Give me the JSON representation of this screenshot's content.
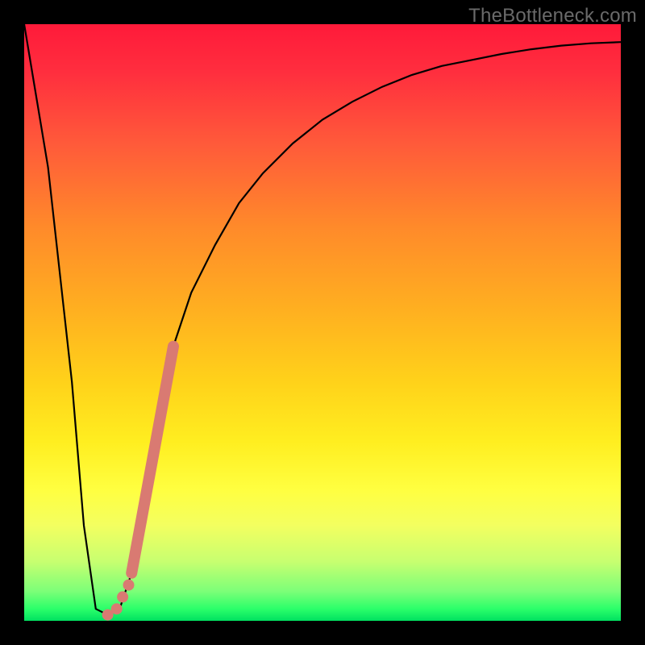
{
  "watermark": "TheBottleneck.com",
  "colors": {
    "marker": "#d97a72",
    "curve": "#000000"
  },
  "chart_data": {
    "type": "line",
    "title": "",
    "xlabel": "",
    "ylabel": "",
    "xlim": [
      0,
      100
    ],
    "ylim": [
      0,
      100
    ],
    "grid": false,
    "legend": false,
    "series": [
      {
        "name": "bottleneck-curve",
        "x": [
          0,
          4,
          8,
          10,
          12,
          14,
          16,
          18,
          20,
          22,
          25,
          28,
          32,
          36,
          40,
          45,
          50,
          55,
          60,
          65,
          70,
          75,
          80,
          85,
          90,
          95,
          100
        ],
        "y": [
          100,
          76,
          40,
          16,
          2,
          1,
          2,
          8,
          20,
          33,
          46,
          55,
          63,
          70,
          75,
          80,
          84,
          87,
          89.5,
          91.5,
          93,
          94,
          95,
          95.8,
          96.4,
          96.8,
          97
        ]
      }
    ],
    "markers": {
      "segment": {
        "x0": 18,
        "y0": 8,
        "x1": 25,
        "y1": 46
      },
      "dots": [
        {
          "x": 16.5,
          "y": 4
        },
        {
          "x": 15.5,
          "y": 2
        },
        {
          "x": 14.0,
          "y": 1
        },
        {
          "x": 17.5,
          "y": 6
        }
      ]
    }
  }
}
